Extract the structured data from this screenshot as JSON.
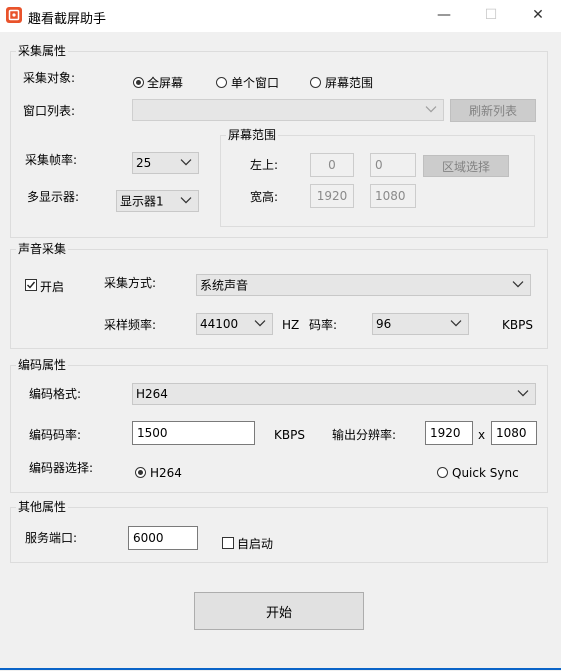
{
  "window": {
    "title": "趣看截屏助手",
    "minimize_glyph": "—",
    "maximize_glyph": "☐",
    "close_glyph": "✕"
  },
  "capture": {
    "group_label": "采集属性",
    "target_label": "采集对象:",
    "target_options": [
      "全屏幕",
      "单个窗口",
      "屏幕范围"
    ],
    "target_selected": "全屏幕",
    "window_list_label": "窗口列表:",
    "window_list_value": "",
    "refresh_label": "刷新列表",
    "fps_label": "采集帧率:",
    "fps_value": "25",
    "monitor_label": "多显示器:",
    "monitor_value": "显示器1",
    "range": {
      "group_label": "屏幕范围",
      "topleft_label": "左上:",
      "x": "0",
      "y": "0",
      "select_label": "区域选择",
      "size_label": "宽高:",
      "width": "1920",
      "height": "1080"
    }
  },
  "audio": {
    "group_label": "声音采集",
    "enable_label": "开启",
    "enabled": true,
    "method_label": "采集方式:",
    "method_value": "系统声音",
    "sample_rate_label": "采样频率:",
    "sample_rate_value": "44100",
    "sample_rate_unit": "HZ",
    "bitrate_label": "码率:",
    "bitrate_value": "96",
    "bitrate_unit": "KBPS"
  },
  "encode": {
    "group_label": "编码属性",
    "format_label": "编码格式:",
    "format_value": "H264",
    "bitrate_label": "编码码率:",
    "bitrate_value": "1500",
    "bitrate_unit": "KBPS",
    "resolution_label": "输出分辨率:",
    "res_width": "1920",
    "res_x": "x",
    "res_height": "1080",
    "encoder_label": "编码器选择:",
    "encoder_options": [
      "H264",
      "Quick Sync"
    ],
    "encoder_selected": "H264"
  },
  "other": {
    "group_label": "其他属性",
    "port_label": "服务端口:",
    "port_value": "6000",
    "autostart_label": "自启动",
    "autostart": false
  },
  "start_label": "开始",
  "colors": {
    "accent_border": "#0a64c8",
    "app_icon": "#e9532b",
    "window_bg": "#f0f0f0"
  }
}
